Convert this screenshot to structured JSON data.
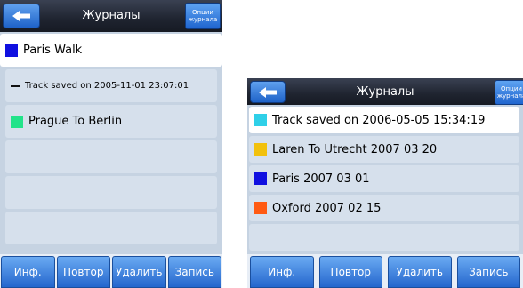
{
  "screen1": {
    "title": "Журналы",
    "options_label_1": "Опции",
    "options_label_2": "журнала",
    "items": [
      {
        "label": "Paris Walk",
        "color": "#1010e0",
        "marker": "swatch",
        "selected": true
      },
      {
        "label": "Track saved on 2005-11-01 23:07:01",
        "color": "#111111",
        "marker": "dash",
        "selected": false
      },
      {
        "label": "Prague To Berlin",
        "color": "#22e38a",
        "marker": "swatch",
        "selected": false
      },
      {
        "label": "",
        "marker": "none"
      },
      {
        "label": "",
        "marker": "none"
      },
      {
        "label": "",
        "marker": "none"
      }
    ],
    "buttons": [
      "Инф.",
      "Повтор",
      "Удалить",
      "Запись"
    ]
  },
  "screen2": {
    "title": "Журналы",
    "options_label_1": "Опции",
    "options_label_2": "журнала",
    "items": [
      {
        "label": "Track saved on 2006-05-05 15:34:19",
        "color": "#2fd0e8",
        "marker": "swatch",
        "selected": true
      },
      {
        "label": "Laren To Utrecht 2007 03 20",
        "color": "#f2c10c",
        "marker": "swatch",
        "selected": false
      },
      {
        "label": "Paris 2007 03 01",
        "color": "#1010e0",
        "marker": "swatch",
        "selected": false
      },
      {
        "label": "Oxford 2007 02 15",
        "color": "#ff5a12",
        "marker": "swatch",
        "selected": false
      },
      {
        "label": "",
        "marker": "none"
      }
    ],
    "buttons": [
      "Инф.",
      "Повтор",
      "Удалить",
      "Запись"
    ]
  }
}
